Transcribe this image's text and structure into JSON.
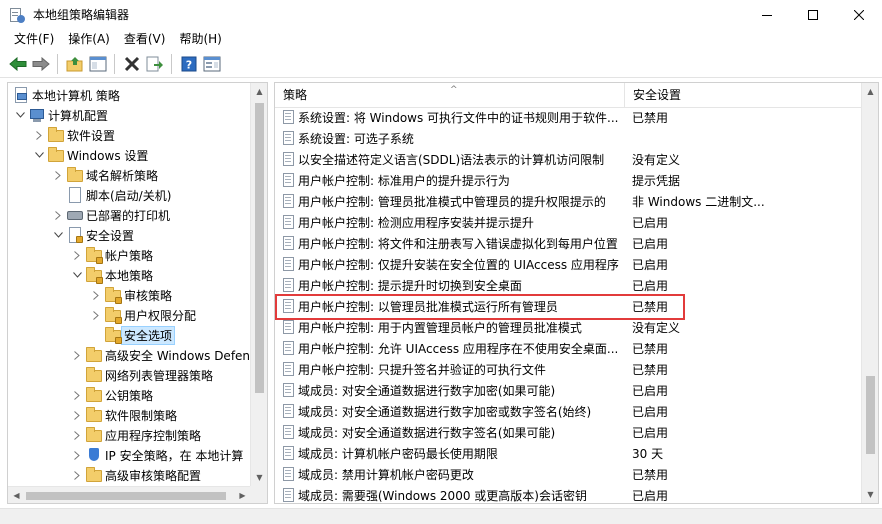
{
  "window": {
    "title": "本地组策略编辑器"
  },
  "menu": [
    "文件(F)",
    "操作(A)",
    "查看(V)",
    "帮助(H)"
  ],
  "toolbar": {
    "buttons": [
      "back-icon",
      "forward-icon",
      "up-folder-icon",
      "show-hide-tree-icon",
      "delete-icon",
      "export-list-icon",
      "help-icon",
      "properties-icon"
    ]
  },
  "tree": {
    "items": [
      {
        "label": "本地计算机 策略",
        "depth": 0,
        "toggle": "",
        "icon": "computer-policy-icon"
      },
      {
        "label": "计算机配置",
        "depth": 1,
        "toggle": "v",
        "icon": "computer-icon"
      },
      {
        "label": "软件设置",
        "depth": 2,
        "toggle": ">",
        "icon": "folder-icon"
      },
      {
        "label": "Windows 设置",
        "depth": 2,
        "toggle": "v",
        "icon": "folder-icon"
      },
      {
        "label": "域名解析策略",
        "depth": 3,
        "toggle": ">",
        "icon": "folder-icon"
      },
      {
        "label": "脚本(启动/关机)",
        "depth": 3,
        "toggle": "",
        "icon": "script-icon"
      },
      {
        "label": "已部署的打印机",
        "depth": 3,
        "toggle": ">",
        "icon": "printer-icon"
      },
      {
        "label": "安全设置",
        "depth": 3,
        "toggle": "v",
        "icon": "security-icon"
      },
      {
        "label": "帐户策略",
        "depth": 4,
        "toggle": ">",
        "icon": "locked-folder-icon"
      },
      {
        "label": "本地策略",
        "depth": 4,
        "toggle": "v",
        "icon": "locked-folder-icon"
      },
      {
        "label": "审核策略",
        "depth": 5,
        "toggle": ">",
        "icon": "locked-folder-icon"
      },
      {
        "label": "用户权限分配",
        "depth": 5,
        "toggle": ">",
        "icon": "locked-folder-icon"
      },
      {
        "label": "安全选项",
        "depth": 5,
        "toggle": "",
        "icon": "locked-folder-icon",
        "selected": true
      },
      {
        "label": "高级安全 Windows Defen",
        "depth": 4,
        "toggle": ">",
        "icon": "folder-icon"
      },
      {
        "label": "网络列表管理器策略",
        "depth": 4,
        "toggle": "",
        "icon": "folder-icon"
      },
      {
        "label": "公钥策略",
        "depth": 4,
        "toggle": ">",
        "icon": "folder-icon"
      },
      {
        "label": "软件限制策略",
        "depth": 4,
        "toggle": ">",
        "icon": "folder-icon"
      },
      {
        "label": "应用程序控制策略",
        "depth": 4,
        "toggle": ">",
        "icon": "folder-icon"
      },
      {
        "label": "IP 安全策略，在 本地计算",
        "depth": 4,
        "toggle": ">",
        "icon": "ip-security-icon"
      },
      {
        "label": "高级审核策略配置",
        "depth": 4,
        "toggle": ">",
        "icon": "folder-icon"
      }
    ]
  },
  "list": {
    "columns": {
      "policy": "策略",
      "setting": "安全设置"
    },
    "rows": [
      {
        "policy": "系统设置: 将 Windows 可执行文件中的证书规则用于软件...",
        "setting": "已禁用"
      },
      {
        "policy": "系统设置: 可选子系统",
        "setting": ""
      },
      {
        "policy": "以安全描述符定义语言(SDDL)语法表示的计算机访问限制",
        "setting": "没有定义"
      },
      {
        "policy": "用户帐户控制: 标准用户的提升提示行为",
        "setting": "提示凭据"
      },
      {
        "policy": "用户帐户控制: 管理员批准模式中管理员的提升权限提示的",
        "setting": "非 Windows 二进制文..."
      },
      {
        "policy": "用户帐户控制: 检测应用程序安装并提示提升",
        "setting": "已启用"
      },
      {
        "policy": "用户帐户控制: 将文件和注册表写入错误虚拟化到每用户位置",
        "setting": "已启用"
      },
      {
        "policy": "用户帐户控制: 仅提升安装在安全位置的 UIAccess 应用程序",
        "setting": "已启用"
      },
      {
        "policy": "用户帐户控制: 提示提升时切换到安全桌面",
        "setting": "已启用"
      },
      {
        "policy": "用户帐户控制: 以管理员批准模式运行所有管理员",
        "setting": "已禁用"
      },
      {
        "policy": "用户帐户控制: 用于内置管理员帐户的管理员批准模式",
        "setting": "没有定义"
      },
      {
        "policy": "用户帐户控制: 允许 UIAccess 应用程序在不使用安全桌面...",
        "setting": "已禁用"
      },
      {
        "policy": "用户帐户控制: 只提升签名并验证的可执行文件",
        "setting": "已禁用"
      },
      {
        "policy": "域成员: 对安全通道数据进行数字加密(如果可能)",
        "setting": "已启用"
      },
      {
        "policy": "域成员: 对安全通道数据进行数字加密或数字签名(始终)",
        "setting": "已启用"
      },
      {
        "policy": "域成员: 对安全通道数据进行数字签名(如果可能)",
        "setting": "已启用"
      },
      {
        "policy": "域成员: 计算机帐户密码最长使用期限",
        "setting": "30 天"
      },
      {
        "policy": "域成员: 禁用计算机帐户密码更改",
        "setting": "已禁用"
      },
      {
        "policy": "域成员: 需要强(Windows 2000 或更高版本)会话密钥",
        "setting": "已启用"
      }
    ],
    "highlighted_row": 9
  }
}
